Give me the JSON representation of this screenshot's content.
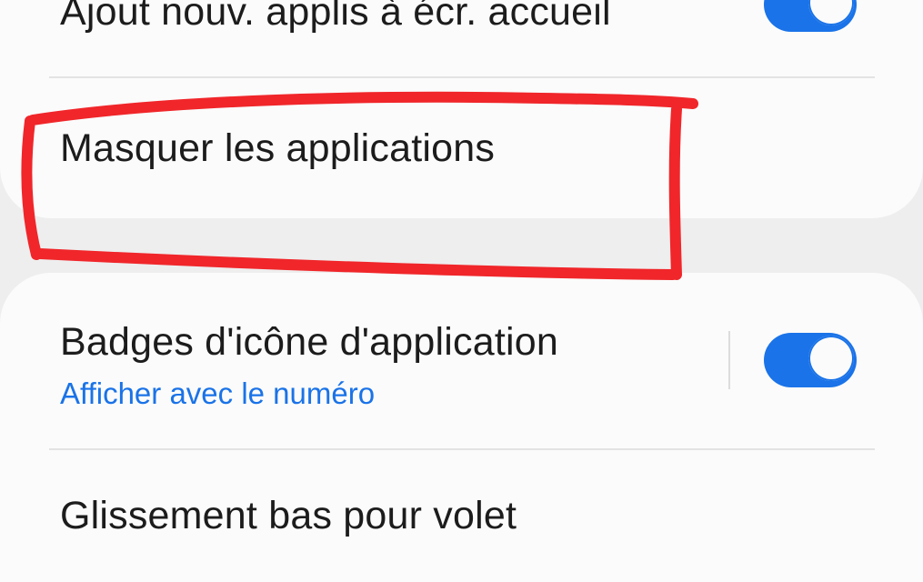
{
  "settings": {
    "items": [
      {
        "title": "Ajout nouv. applis à écr. accueil",
        "toggle_on": true
      },
      {
        "title": "Masquer les applications"
      },
      {
        "title": "Badges d'icône d'application",
        "subtitle": "Afficher avec le numéro",
        "toggle_on": true
      },
      {
        "title": "Glissement bas pour volet"
      }
    ]
  },
  "colors": {
    "accent": "#1a73e8",
    "subtitle": "#1a73e8",
    "annotation": "#f0262a",
    "background": "#eeeeee",
    "card": "#fbfbfb"
  },
  "icons": {
    "annotation": "red-highlight-rectangle"
  }
}
